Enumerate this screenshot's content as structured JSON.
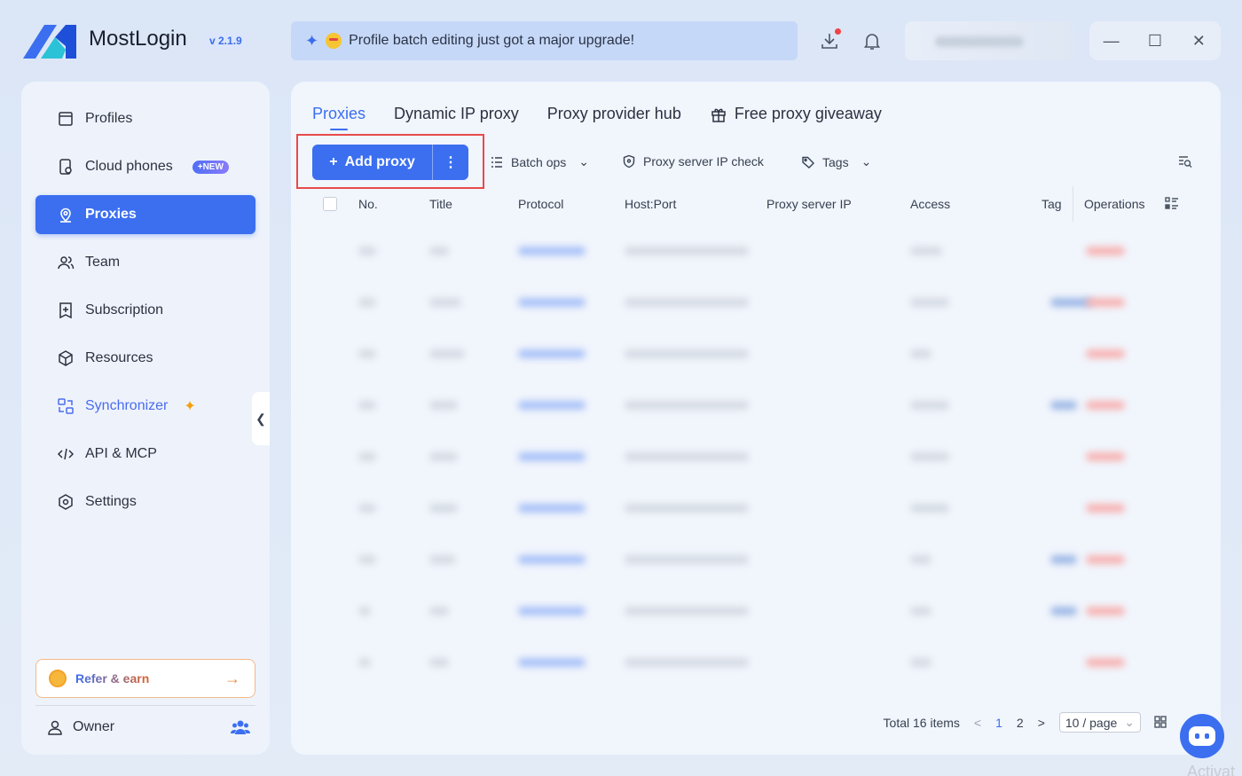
{
  "app": {
    "name": "MostLogin",
    "version": "v 2.1.9"
  },
  "banner": {
    "text": "Profile batch editing just got a major upgrade!"
  },
  "window_controls": {
    "minimize": "—",
    "maximize": "☐",
    "close": "✕"
  },
  "sidebar": {
    "items": [
      {
        "label": "Profiles",
        "icon": "profiles-icon"
      },
      {
        "label": "Cloud phones",
        "icon": "phone-icon",
        "badge": "+NEW"
      },
      {
        "label": "Proxies",
        "icon": "location-icon"
      },
      {
        "label": "Team",
        "icon": "team-icon"
      },
      {
        "label": "Subscription",
        "icon": "subscription-icon"
      },
      {
        "label": "Resources",
        "icon": "cube-icon"
      },
      {
        "label": "Synchronizer",
        "icon": "sync-icon"
      },
      {
        "label": "API & MCP",
        "icon": "code-icon"
      },
      {
        "label": "Settings",
        "icon": "settings-icon"
      }
    ],
    "refer_label": "Refer & earn",
    "owner_label": "Owner"
  },
  "tabs": [
    "Proxies",
    "Dynamic IP proxy",
    "Proxy provider hub",
    "Free proxy giveaway"
  ],
  "toolbar": {
    "add_label": "Add proxy",
    "batch_label": "Batch ops",
    "check_label": "Proxy server IP check",
    "tags_label": "Tags"
  },
  "table": {
    "columns": [
      "No.",
      "Title",
      "Protocol",
      "Host:Port",
      "Proxy server IP",
      "Access",
      "Tag",
      "Operations"
    ],
    "row_count": 9
  },
  "pagination": {
    "total": "Total 16 items",
    "page1": "1",
    "page2": "2",
    "page_size": "10 / page",
    "prev": "<",
    "next": ">"
  },
  "watermark": "Activat"
}
